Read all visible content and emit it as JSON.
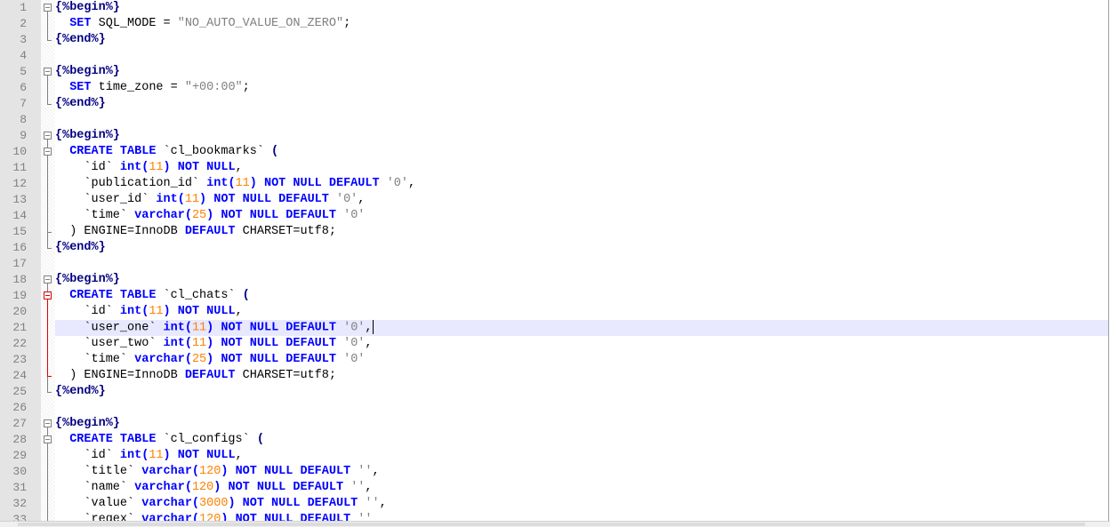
{
  "editor": {
    "current_line": 21,
    "lines": [
      {
        "num": "1",
        "fold": "open",
        "t": [
          [
            "{%begin%}",
            "o"
          ]
        ]
      },
      {
        "num": "2",
        "fold": "line",
        "t": [
          [
            "  ",
            "t"
          ],
          [
            "SET",
            "k"
          ],
          [
            " SQL_MODE = ",
            "t"
          ],
          [
            "\"NO_AUTO_VALUE_ON_ZERO\"",
            "s"
          ],
          [
            ";",
            "t"
          ]
        ]
      },
      {
        "num": "3",
        "fold": "end",
        "t": [
          [
            "{%end%}",
            "o"
          ]
        ]
      },
      {
        "num": "4",
        "fold": "",
        "t": []
      },
      {
        "num": "5",
        "fold": "open",
        "t": [
          [
            "{%begin%}",
            "o"
          ]
        ]
      },
      {
        "num": "6",
        "fold": "line",
        "t": [
          [
            "  ",
            "t"
          ],
          [
            "SET",
            "k"
          ],
          [
            " time_zone = ",
            "t"
          ],
          [
            "\"+00:00\"",
            "s"
          ],
          [
            ";",
            "t"
          ]
        ]
      },
      {
        "num": "7",
        "fold": "end",
        "t": [
          [
            "{%end%}",
            "o"
          ]
        ]
      },
      {
        "num": "8",
        "fold": "",
        "t": []
      },
      {
        "num": "9",
        "fold": "open",
        "t": [
          [
            "{%begin%}",
            "o"
          ]
        ]
      },
      {
        "num": "10",
        "fold": "open2",
        "t": [
          [
            "  ",
            "t"
          ],
          [
            "CREATE TABLE",
            "k"
          ],
          [
            " `cl_bookmarks` ",
            "t"
          ],
          [
            "(",
            "o"
          ]
        ]
      },
      {
        "num": "11",
        "fold": "line",
        "t": [
          [
            "    `id` ",
            "t"
          ],
          [
            "int(",
            "k"
          ],
          [
            "11",
            "n"
          ],
          [
            ")",
            "k"
          ],
          [
            " ",
            "t"
          ],
          [
            "NOT NULL",
            "k"
          ],
          [
            ",",
            "t"
          ]
        ]
      },
      {
        "num": "12",
        "fold": "line",
        "t": [
          [
            "    `publication_id` ",
            "t"
          ],
          [
            "int(",
            "k"
          ],
          [
            "11",
            "n"
          ],
          [
            ")",
            "k"
          ],
          [
            " ",
            "t"
          ],
          [
            "NOT NULL DEFAULT",
            "k"
          ],
          [
            " ",
            "t"
          ],
          [
            "'0'",
            "s"
          ],
          [
            ",",
            "t"
          ]
        ]
      },
      {
        "num": "13",
        "fold": "line",
        "t": [
          [
            "    `user_id` ",
            "t"
          ],
          [
            "int(",
            "k"
          ],
          [
            "11",
            "n"
          ],
          [
            ")",
            "k"
          ],
          [
            " ",
            "t"
          ],
          [
            "NOT NULL DEFAULT",
            "k"
          ],
          [
            " ",
            "t"
          ],
          [
            "'0'",
            "s"
          ],
          [
            ",",
            "t"
          ]
        ]
      },
      {
        "num": "14",
        "fold": "line",
        "t": [
          [
            "    `time` ",
            "t"
          ],
          [
            "varchar(",
            "k"
          ],
          [
            "25",
            "n"
          ],
          [
            ")",
            "k"
          ],
          [
            " ",
            "t"
          ],
          [
            "NOT NULL DEFAULT",
            "k"
          ],
          [
            " ",
            "t"
          ],
          [
            "'0'",
            "s"
          ]
        ]
      },
      {
        "num": "15",
        "fold": "mid",
        "t": [
          [
            "  ) ENGINE=InnoDB ",
            "t"
          ],
          [
            "DEFAULT",
            "k"
          ],
          [
            " CHARSET=utf8;",
            "t"
          ]
        ]
      },
      {
        "num": "16",
        "fold": "end",
        "t": [
          [
            "{%end%}",
            "o"
          ]
        ]
      },
      {
        "num": "17",
        "fold": "",
        "t": []
      },
      {
        "num": "18",
        "fold": "open",
        "t": [
          [
            "{%begin%}",
            "o"
          ]
        ]
      },
      {
        "num": "19",
        "fold": "open2red",
        "t": [
          [
            "  ",
            "t"
          ],
          [
            "CREATE TABLE",
            "k"
          ],
          [
            " `cl_chats` ",
            "t"
          ],
          [
            "(",
            "o"
          ]
        ]
      },
      {
        "num": "20",
        "fold": "linered",
        "t": [
          [
            "    `id` ",
            "t"
          ],
          [
            "int(",
            "k"
          ],
          [
            "11",
            "n"
          ],
          [
            ")",
            "k"
          ],
          [
            " ",
            "t"
          ],
          [
            "NOT NULL",
            "k"
          ],
          [
            ",",
            "t"
          ]
        ]
      },
      {
        "num": "21",
        "fold": "linered",
        "t": [
          [
            "    `user_one` ",
            "t"
          ],
          [
            "int(",
            "k"
          ],
          [
            "11",
            "n"
          ],
          [
            ")",
            "k"
          ],
          [
            " ",
            "t"
          ],
          [
            "NOT NULL DEFAULT",
            "k"
          ],
          [
            " ",
            "t"
          ],
          [
            "'0'",
            "s"
          ],
          [
            ",",
            "t"
          ]
        ]
      },
      {
        "num": "22",
        "fold": "linered",
        "t": [
          [
            "    `user_two` ",
            "t"
          ],
          [
            "int(",
            "k"
          ],
          [
            "11",
            "n"
          ],
          [
            ")",
            "k"
          ],
          [
            " ",
            "t"
          ],
          [
            "NOT NULL DEFAULT",
            "k"
          ],
          [
            " ",
            "t"
          ],
          [
            "'0'",
            "s"
          ],
          [
            ",",
            "t"
          ]
        ]
      },
      {
        "num": "23",
        "fold": "linered",
        "t": [
          [
            "    `time` ",
            "t"
          ],
          [
            "varchar(",
            "k"
          ],
          [
            "25",
            "n"
          ],
          [
            ")",
            "k"
          ],
          [
            " ",
            "t"
          ],
          [
            "NOT NULL DEFAULT",
            "k"
          ],
          [
            " ",
            "t"
          ],
          [
            "'0'",
            "s"
          ]
        ]
      },
      {
        "num": "24",
        "fold": "midred",
        "t": [
          [
            "  ) ENGINE=InnoDB ",
            "t"
          ],
          [
            "DEFAULT",
            "k"
          ],
          [
            " CHARSET=utf8;",
            "t"
          ]
        ]
      },
      {
        "num": "25",
        "fold": "end",
        "t": [
          [
            "{%end%}",
            "o"
          ]
        ]
      },
      {
        "num": "26",
        "fold": "",
        "t": []
      },
      {
        "num": "27",
        "fold": "open",
        "t": [
          [
            "{%begin%}",
            "o"
          ]
        ]
      },
      {
        "num": "28",
        "fold": "open2",
        "t": [
          [
            "  ",
            "t"
          ],
          [
            "CREATE TABLE",
            "k"
          ],
          [
            " `cl_configs` ",
            "t"
          ],
          [
            "(",
            "o"
          ]
        ]
      },
      {
        "num": "29",
        "fold": "line",
        "t": [
          [
            "    `id` ",
            "t"
          ],
          [
            "int(",
            "k"
          ],
          [
            "11",
            "n"
          ],
          [
            ")",
            "k"
          ],
          [
            " ",
            "t"
          ],
          [
            "NOT NULL",
            "k"
          ],
          [
            ",",
            "t"
          ]
        ]
      },
      {
        "num": "30",
        "fold": "line",
        "t": [
          [
            "    `title` ",
            "t"
          ],
          [
            "varchar(",
            "k"
          ],
          [
            "120",
            "n"
          ],
          [
            ")",
            "k"
          ],
          [
            " ",
            "t"
          ],
          [
            "NOT NULL DEFAULT",
            "k"
          ],
          [
            " ",
            "t"
          ],
          [
            "''",
            "s"
          ],
          [
            ",",
            "t"
          ]
        ]
      },
      {
        "num": "31",
        "fold": "line",
        "t": [
          [
            "    `name` ",
            "t"
          ],
          [
            "varchar(",
            "k"
          ],
          [
            "120",
            "n"
          ],
          [
            ")",
            "k"
          ],
          [
            " ",
            "t"
          ],
          [
            "NOT NULL DEFAULT",
            "k"
          ],
          [
            " ",
            "t"
          ],
          [
            "''",
            "s"
          ],
          [
            ",",
            "t"
          ]
        ]
      },
      {
        "num": "32",
        "fold": "line",
        "t": [
          [
            "    `value` ",
            "t"
          ],
          [
            "varchar(",
            "k"
          ],
          [
            "3000",
            "n"
          ],
          [
            ")",
            "k"
          ],
          [
            " ",
            "t"
          ],
          [
            "NOT NULL DEFAULT",
            "k"
          ],
          [
            " ",
            "t"
          ],
          [
            "''",
            "s"
          ],
          [
            ",",
            "t"
          ]
        ]
      },
      {
        "num": "33",
        "fold": "line",
        "t": [
          [
            "    `regex` ",
            "t"
          ],
          [
            "varchar(",
            "k"
          ],
          [
            "120",
            "n"
          ],
          [
            ")",
            "k"
          ],
          [
            " ",
            "t"
          ],
          [
            "NOT NULL DEFAULT",
            "k"
          ],
          [
            " ",
            "t"
          ],
          [
            "''",
            "s"
          ]
        ]
      }
    ]
  }
}
